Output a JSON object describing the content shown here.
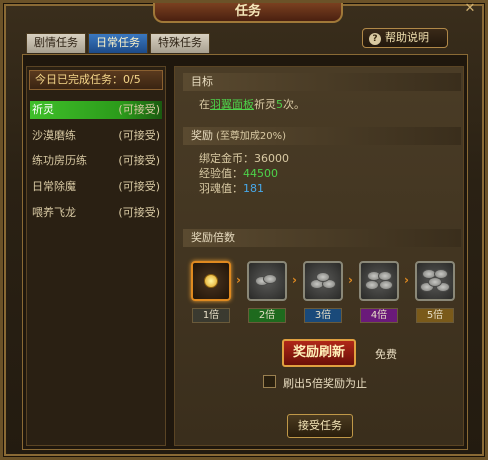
{
  "window": {
    "title": "任务",
    "close_glyph": "✕"
  },
  "tabs": [
    {
      "label": "剧情任务",
      "active": false
    },
    {
      "label": "日常任务",
      "active": true
    },
    {
      "label": "特殊任务",
      "active": false
    }
  ],
  "help": {
    "label": "帮助说明",
    "icon": "question-icon",
    "glyph": "?"
  },
  "left": {
    "header": "今日已完成任务：0/5",
    "quests": [
      {
        "name": "祈灵",
        "state": "(可接受)",
        "selected": true
      },
      {
        "name": "沙漠磨练",
        "state": "(可接受)",
        "selected": false
      },
      {
        "name": "练功房历练",
        "state": "(可接受)",
        "selected": false
      },
      {
        "name": "日常除魔",
        "state": "(可接受)",
        "selected": false
      },
      {
        "name": "喂养飞龙",
        "state": "(可接受)",
        "selected": false
      }
    ]
  },
  "goal": {
    "heading": "目标",
    "text_prefix": "在",
    "text_link": "羽翼面板",
    "text_mid": "祈灵",
    "text_count": "5",
    "text_suffix": "次。"
  },
  "reward": {
    "heading": "奖励",
    "subheading": "(至尊加成20%)",
    "gold_label": "绑定金币：",
    "gold_value": "36000",
    "exp_label": "经验值：",
    "exp_value": "44500",
    "soul_label": "羽魂值：",
    "soul_value": "181"
  },
  "multiplier": {
    "heading": "奖励倍数",
    "labels": [
      "1倍",
      "2倍",
      "3倍",
      "4倍",
      "5倍"
    ],
    "label_colors": [
      "#3a3a30",
      "#1e6a1e",
      "#1a4a7a",
      "#6a1a7a",
      "#7a5a1a"
    ],
    "active_index": 0,
    "arrow_glyph": "›"
  },
  "refresh": {
    "label": "奖励刷新",
    "cost": "免费"
  },
  "auto_refresh": {
    "label": "刷出5倍奖励为止",
    "checked": false
  },
  "accept": {
    "label": "接受任务"
  },
  "colors": {
    "accent": "#e08a20",
    "green": "#4ed24a",
    "blue": "#48a8e8"
  }
}
